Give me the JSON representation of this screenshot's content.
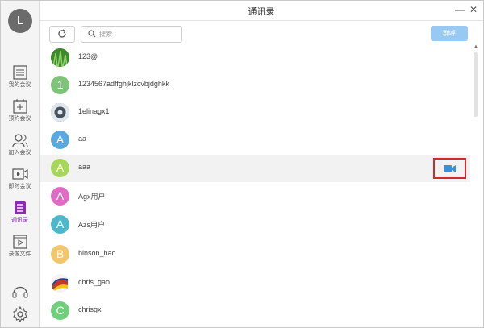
{
  "window": {
    "title": "通讯录"
  },
  "user": {
    "initial": "L"
  },
  "nav": [
    {
      "key": "my-meetings",
      "label": "我的会议"
    },
    {
      "key": "schedule-meeting",
      "label": "预约会议"
    },
    {
      "key": "join-meeting",
      "label": "加入会议"
    },
    {
      "key": "instant-meeting",
      "label": "即时会议"
    },
    {
      "key": "contacts",
      "label": "通讯录",
      "active": true
    },
    {
      "key": "recordings",
      "label": "录像文件"
    }
  ],
  "toolbar": {
    "search_placeholder": "搜索",
    "confirm_label": "群呼"
  },
  "contacts": [
    {
      "initial": "",
      "name": "123@",
      "color": "#3d8a2a",
      "photo": "grass"
    },
    {
      "initial": "1",
      "name": "1234567adffghjklzcvbjdghkk",
      "color": "#7cc576"
    },
    {
      "initial": "",
      "name": "1elinagx1",
      "color": "#6b7d8c",
      "photo": "pattern"
    },
    {
      "initial": "A",
      "name": "aa",
      "color": "#5aa8e0"
    },
    {
      "initial": "A",
      "name": "aaa",
      "color": "#a6d65a",
      "hover": true
    },
    {
      "initial": "A",
      "name": "Agx用户",
      "color": "#e06bc5"
    },
    {
      "initial": "A",
      "name": "Azs用户",
      "color": "#4db8cc"
    },
    {
      "initial": "B",
      "name": "binson_hao",
      "color": "#f3c66b"
    },
    {
      "initial": "",
      "name": "chris_gao",
      "color": "#c0392b",
      "photo": "flag"
    },
    {
      "initial": "C",
      "name": "chrisgx",
      "color": "#6fcf7a"
    }
  ],
  "colors": {
    "accent": "#8b2cb3",
    "confirm_button": "#98c9f3",
    "highlight_border": "#d02b2b",
    "video_icon": "#3a8fd9"
  }
}
